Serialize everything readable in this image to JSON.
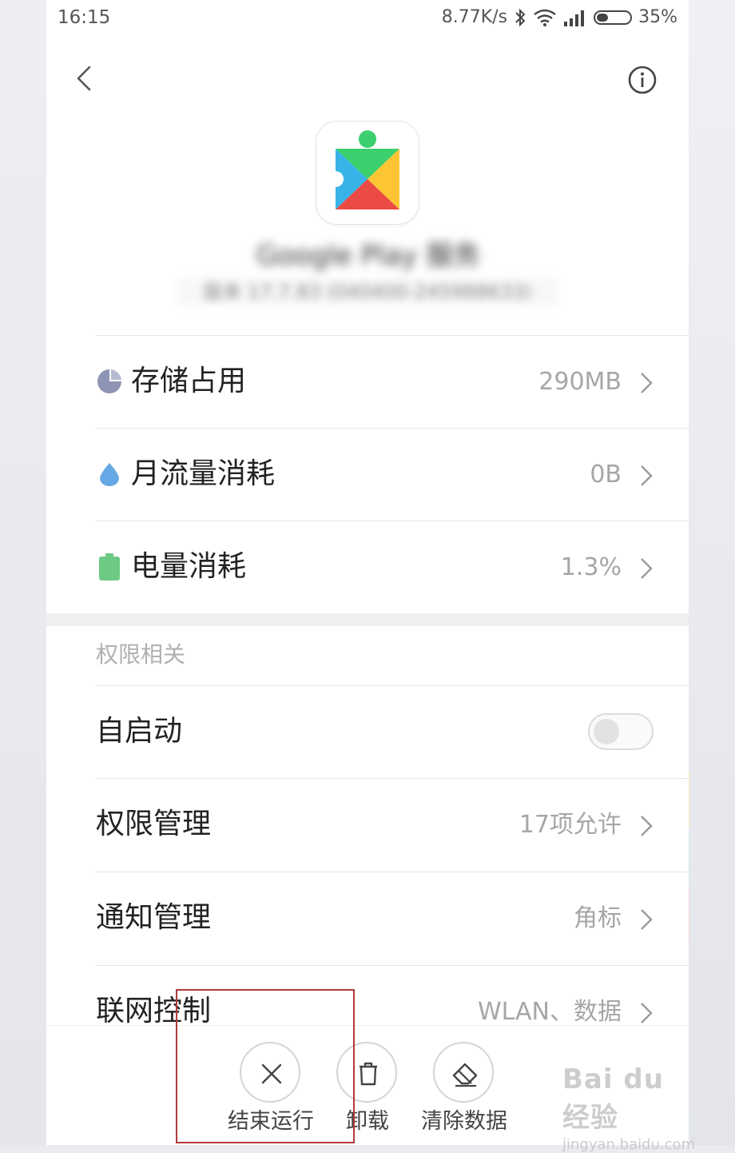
{
  "status_bar": {
    "time": "16:15",
    "net_speed": "8.77K/s",
    "battery_pct": "35%",
    "battery_level": 0.35
  },
  "app": {
    "name": "Google Play 服务",
    "version": "版本 17.7.83 (040400-245988633)"
  },
  "usage_rows": [
    {
      "label": "存储占用",
      "value": "290MB",
      "icon": "storage-pie-icon",
      "icon_color": "#8e94b3"
    },
    {
      "label": "月流量消耗",
      "value": "0B",
      "icon": "data-drop-icon",
      "icon_color": "#66a8e6"
    },
    {
      "label": "电量消耗",
      "value": "1.3%",
      "icon": "battery-icon",
      "icon_color": "#6dc983"
    }
  ],
  "permissions_section": {
    "title": "权限相关",
    "autostart_label": "自启动",
    "autostart_enabled": false,
    "rows": [
      {
        "label": "权限管理",
        "value": "17项允许"
      },
      {
        "label": "通知管理",
        "value": "角标"
      },
      {
        "label": "联网控制",
        "value": "WLAN、数据"
      }
    ]
  },
  "actions": [
    {
      "label": "结束运行",
      "icon": "close-icon"
    },
    {
      "label": "卸载",
      "icon": "trash-icon"
    },
    {
      "label": "清除数据",
      "icon": "eraser-icon"
    }
  ],
  "watermark": {
    "brand": "Bai du 经验",
    "url": "jingyan.baidu.com"
  },
  "colors": {
    "highlight": "#b23a3a",
    "secondary_text": "#a6a6a6"
  }
}
